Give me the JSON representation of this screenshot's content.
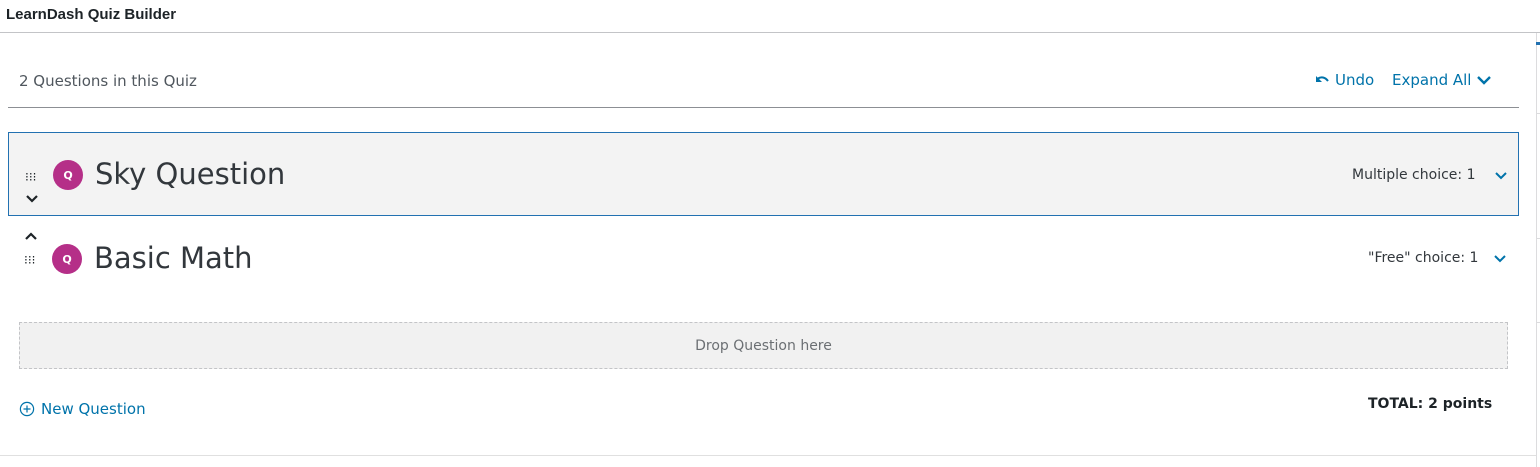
{
  "panel": {
    "title": "LearnDash Quiz Builder"
  },
  "header": {
    "question_count": "2 Questions in this Quiz",
    "undo_label": "Undo",
    "expand_all_label": "Expand All"
  },
  "questions": [
    {
      "badge": "Q",
      "title": "Sky Question",
      "type_summary": "Multiple choice: 1",
      "state": "selected"
    },
    {
      "badge": "Q",
      "title": "Basic Math",
      "type_summary": "\"Free\" choice: 1",
      "state": "normal"
    }
  ],
  "drop_zone": {
    "label": "Drop Question here"
  },
  "footer": {
    "new_question_label": "New Question",
    "total_label": "TOTAL: 2 points"
  },
  "colors": {
    "accent": "#0073aa",
    "badge": "#b52f88",
    "selected_border": "#2271b1",
    "selected_bg": "#f3f3f3"
  },
  "icons": [
    "undo-icon",
    "chevron-down-icon",
    "drag-handle-icon",
    "move-down-icon",
    "move-up-icon",
    "plus-circle-icon"
  ]
}
